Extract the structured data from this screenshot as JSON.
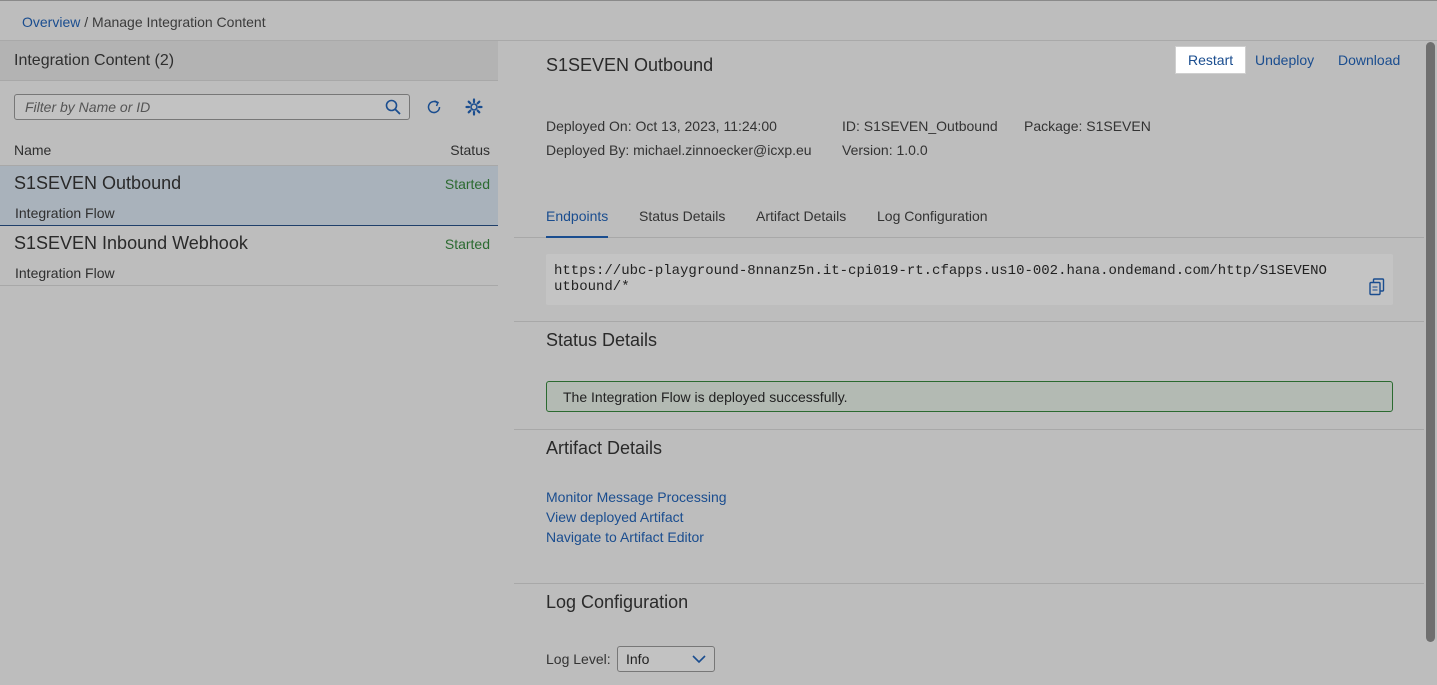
{
  "breadcrumb": {
    "overview": "Overview",
    "separator": "/",
    "current": "Manage Integration Content"
  },
  "left": {
    "title": "Integration Content (2)",
    "search_placeholder": "Filter by Name or ID",
    "columns": {
      "name": "Name",
      "status": "Status"
    },
    "items": [
      {
        "title": "S1SEVEN Outbound",
        "subtitle": "Integration Flow",
        "status": "Started",
        "selected": true
      },
      {
        "title": "S1SEVEN Inbound Webhook",
        "subtitle": "Integration Flow",
        "status": "Started",
        "selected": false
      }
    ]
  },
  "detail": {
    "title": "S1SEVEN Outbound",
    "actions": {
      "restart": "Restart",
      "undeploy": "Undeploy",
      "download": "Download"
    },
    "meta": {
      "deployed_on": "Deployed On: Oct 13, 2023, 11:24:00",
      "deployed_by": "Deployed By: michael.zinnoecker@icxp.eu",
      "id": "ID: S1SEVEN_Outbound",
      "version": "Version: 1.0.0",
      "package": "Package: S1SEVEN"
    },
    "tabs": [
      "Endpoints",
      "Status Details",
      "Artifact Details",
      "Log Configuration"
    ],
    "active_tab": "Endpoints",
    "endpoint": "https://ubc-playground-8nnanz5n.it-cpi019-rt.cfapps.us10-002.hana.ondemand.com/http/S1SEVENOutbound/*",
    "status_section_title": "Status Details",
    "status_message": "The Integration Flow is deployed successfully.",
    "artifact_section_title": "Artifact Details",
    "artifact_links": [
      "Monitor Message Processing",
      "View deployed Artifact",
      "Navigate to Artifact Editor"
    ],
    "log_section_title": "Log Configuration",
    "log_level_label": "Log Level:",
    "log_level_value": "Info"
  },
  "colors": {
    "link": "#1a4d8f",
    "success": "#2b6a30",
    "selected_row": "#a9b2bb",
    "background": "#bdbdbd"
  },
  "icons": [
    "search-icon",
    "refresh-icon",
    "settings-icon",
    "copy-icon",
    "chevron-down-icon"
  ]
}
